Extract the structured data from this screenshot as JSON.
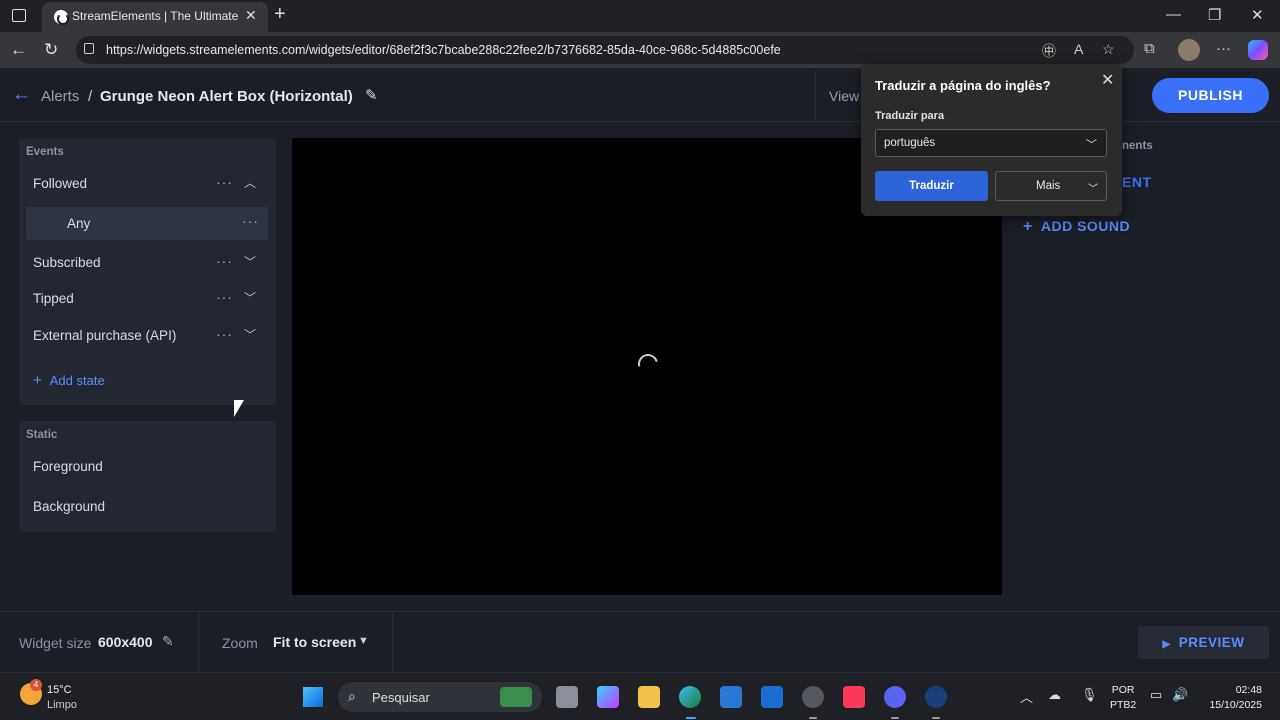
{
  "browser": {
    "tab_title": "StreamElements | The Ultimate St",
    "url": "https://widgets.streamelements.com/widgets/editor/68ef2f3c7bcabe288c22fee2/b7376682-85da-40ce-968c-5d4885c00efe"
  },
  "header": {
    "breadcrumb_parent": "Alerts",
    "separator": "/",
    "title": "Grunge Neon Alert Box (Horizontal)",
    "view_label": "View",
    "publish_label": "PUBLISH"
  },
  "events": {
    "section_label": "Events",
    "items": [
      {
        "label": "Followed",
        "expanded": true
      },
      {
        "label": "Subscribed",
        "expanded": false
      },
      {
        "label": "Tipped",
        "expanded": false
      },
      {
        "label": "External purchase (API)",
        "expanded": false
      }
    ],
    "sub_item": {
      "label": "Any"
    },
    "add_state_label": "Add state"
  },
  "static": {
    "section_label": "Static",
    "items": [
      {
        "label": "Foreground"
      },
      {
        "label": "Background"
      }
    ]
  },
  "right_panel": {
    "elements_label": "nents",
    "add_element_label": "ENT",
    "add_sound_label": "ADD SOUND"
  },
  "bottom": {
    "widget_size_label": "Widget size",
    "widget_size_value": "600x400",
    "zoom_label": "Zoom",
    "zoom_value": "Fit to screen",
    "preview_label": "PREVIEW"
  },
  "translate_popup": {
    "title": "Traduzir a página do inglês?",
    "target_label": "Traduzir para",
    "target_value": "português",
    "translate_button": "Traduzir",
    "more_button": "Mais"
  },
  "taskbar": {
    "weather_badge": "4",
    "temperature": "15°C",
    "condition": "Limpo",
    "search_placeholder": "Pesquisar",
    "lang_top": "POR",
    "lang_bottom": "PTB2",
    "time": "02:48",
    "date": "15/10/2025"
  },
  "colors": {
    "accent": "#3a6ff7",
    "link": "#5b8cff",
    "background": "#1b1e26",
    "panel": "#232731"
  }
}
